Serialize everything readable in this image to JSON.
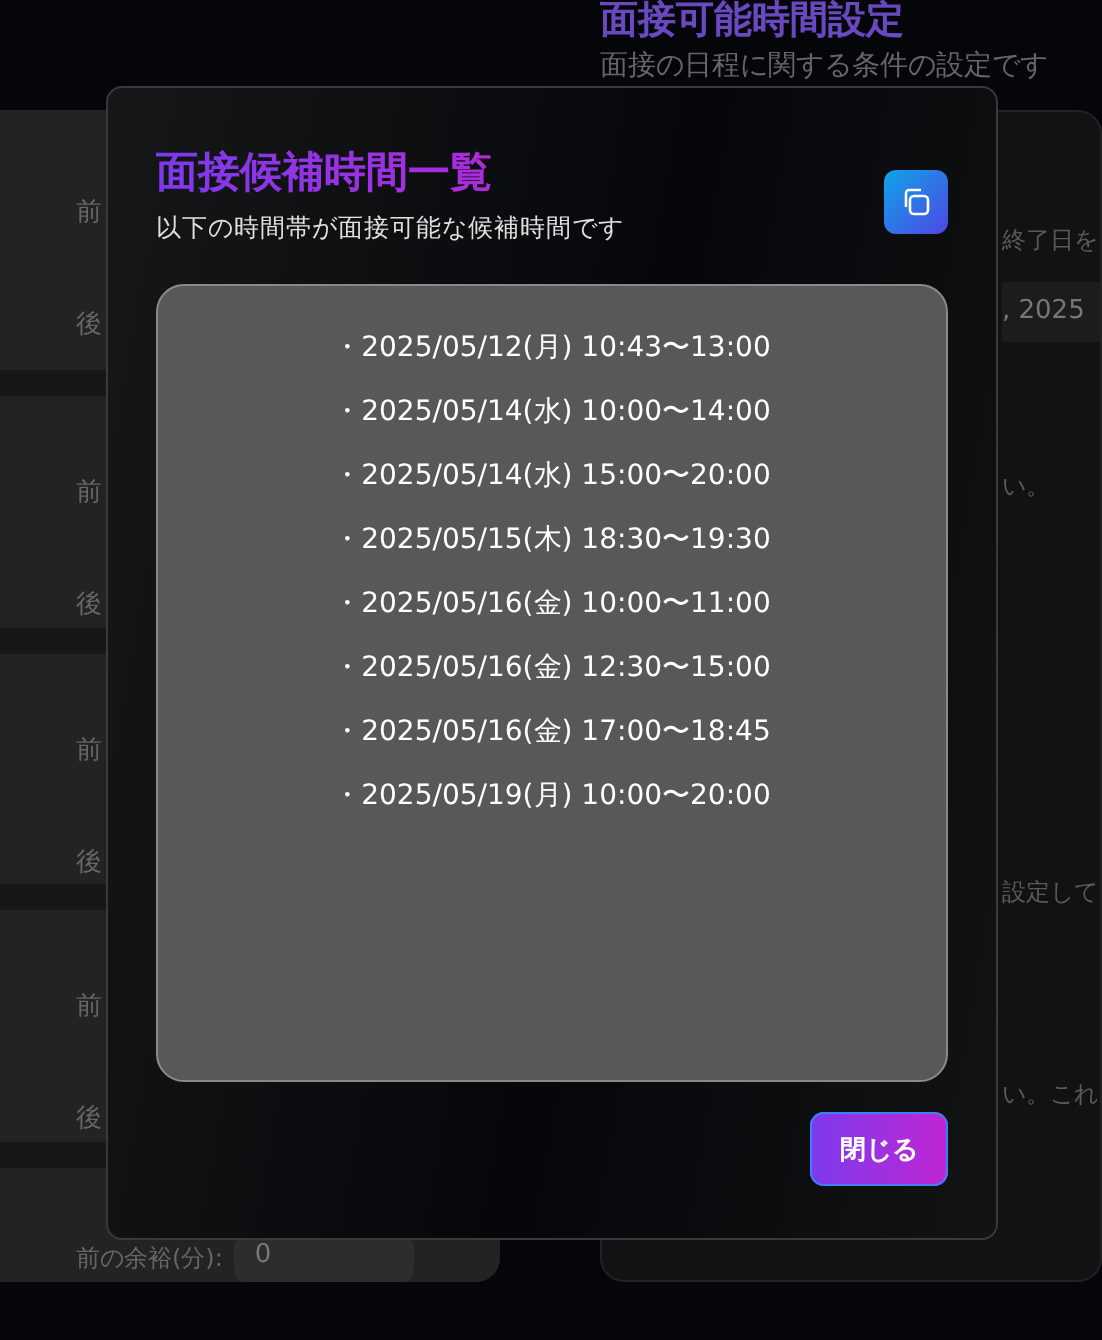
{
  "background": {
    "header": {
      "title": "面接可能時間設定",
      "subtitle": "面接の日程に関する条件の設定です"
    },
    "left_cards": [
      {
        "labels": [
          "前",
          "後"
        ]
      },
      {
        "labels": [
          "前",
          "後"
        ]
      },
      {
        "labels": [
          "前",
          "後"
        ]
      },
      {
        "labels": [
          "前",
          "後"
        ]
      }
    ],
    "margin_row": {
      "label": "前の余裕(分):",
      "value": "0"
    },
    "right_texts": [
      {
        "kind": "text",
        "text": "終了日を"
      },
      {
        "kind": "field",
        "text": ", 2025"
      },
      {
        "kind": "text",
        "text": "い。"
      },
      {
        "kind": "text",
        "text": "設定して"
      },
      {
        "kind": "text",
        "text": "い。これ"
      }
    ]
  },
  "modal": {
    "title": "面接候補時間一覧",
    "subtitle": "以下の時間帯が面接可能な候補時間です",
    "slots": [
      "・2025/05/12(月) 10:43〜13:00",
      "・2025/05/14(水) 10:00〜14:00",
      "・2025/05/14(水) 15:00〜20:00",
      "・2025/05/15(木) 18:30〜19:30",
      "・2025/05/16(金) 10:00〜11:00",
      "・2025/05/16(金) 12:30〜15:00",
      "・2025/05/16(金) 17:00〜18:45",
      "・2025/05/19(月) 10:00〜20:00"
    ],
    "close_button": "閉じる"
  }
}
